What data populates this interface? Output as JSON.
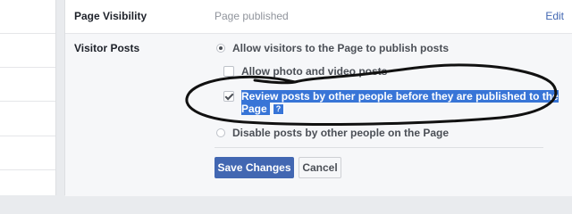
{
  "page_visibility": {
    "label": "Page Visibility",
    "value": "Page published",
    "edit": "Edit"
  },
  "visitor_posts": {
    "label": "Visitor Posts",
    "options": [
      {
        "label": "Allow visitors to the Page to publish posts",
        "type": "radio",
        "checked": true
      },
      {
        "label": "Allow photo and video posts",
        "type": "checkbox",
        "checked": false
      },
      {
        "label_line1": "Review posts by other people before they are published to the",
        "label_line2": "Page",
        "type": "checkbox",
        "checked": true
      },
      {
        "label": "Disable posts by other people on the Page",
        "type": "radio",
        "checked": false
      }
    ]
  },
  "buttons": {
    "save": "Save Changes",
    "cancel": "Cancel"
  },
  "help_icon": "?",
  "colors": {
    "primary": "#4267b2",
    "highlight": "#3875d7",
    "background": "#e9ebee"
  }
}
